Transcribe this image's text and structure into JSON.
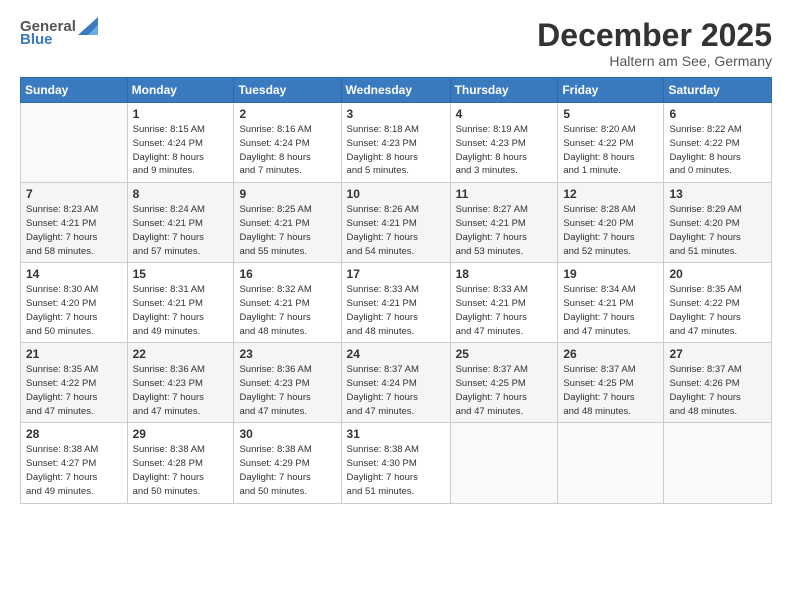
{
  "header": {
    "logo_general": "General",
    "logo_blue": "Blue",
    "month_title": "December 2025",
    "location": "Haltern am See, Germany"
  },
  "weekdays": [
    "Sunday",
    "Monday",
    "Tuesday",
    "Wednesday",
    "Thursday",
    "Friday",
    "Saturday"
  ],
  "weeks": [
    [
      {
        "day": "",
        "info": ""
      },
      {
        "day": "1",
        "info": "Sunrise: 8:15 AM\nSunset: 4:24 PM\nDaylight: 8 hours\nand 9 minutes."
      },
      {
        "day": "2",
        "info": "Sunrise: 8:16 AM\nSunset: 4:24 PM\nDaylight: 8 hours\nand 7 minutes."
      },
      {
        "day": "3",
        "info": "Sunrise: 8:18 AM\nSunset: 4:23 PM\nDaylight: 8 hours\nand 5 minutes."
      },
      {
        "day": "4",
        "info": "Sunrise: 8:19 AM\nSunset: 4:23 PM\nDaylight: 8 hours\nand 3 minutes."
      },
      {
        "day": "5",
        "info": "Sunrise: 8:20 AM\nSunset: 4:22 PM\nDaylight: 8 hours\nand 1 minute."
      },
      {
        "day": "6",
        "info": "Sunrise: 8:22 AM\nSunset: 4:22 PM\nDaylight: 8 hours\nand 0 minutes."
      }
    ],
    [
      {
        "day": "7",
        "info": "Sunrise: 8:23 AM\nSunset: 4:21 PM\nDaylight: 7 hours\nand 58 minutes."
      },
      {
        "day": "8",
        "info": "Sunrise: 8:24 AM\nSunset: 4:21 PM\nDaylight: 7 hours\nand 57 minutes."
      },
      {
        "day": "9",
        "info": "Sunrise: 8:25 AM\nSunset: 4:21 PM\nDaylight: 7 hours\nand 55 minutes."
      },
      {
        "day": "10",
        "info": "Sunrise: 8:26 AM\nSunset: 4:21 PM\nDaylight: 7 hours\nand 54 minutes."
      },
      {
        "day": "11",
        "info": "Sunrise: 8:27 AM\nSunset: 4:21 PM\nDaylight: 7 hours\nand 53 minutes."
      },
      {
        "day": "12",
        "info": "Sunrise: 8:28 AM\nSunset: 4:20 PM\nDaylight: 7 hours\nand 52 minutes."
      },
      {
        "day": "13",
        "info": "Sunrise: 8:29 AM\nSunset: 4:20 PM\nDaylight: 7 hours\nand 51 minutes."
      }
    ],
    [
      {
        "day": "14",
        "info": "Sunrise: 8:30 AM\nSunset: 4:20 PM\nDaylight: 7 hours\nand 50 minutes."
      },
      {
        "day": "15",
        "info": "Sunrise: 8:31 AM\nSunset: 4:21 PM\nDaylight: 7 hours\nand 49 minutes."
      },
      {
        "day": "16",
        "info": "Sunrise: 8:32 AM\nSunset: 4:21 PM\nDaylight: 7 hours\nand 48 minutes."
      },
      {
        "day": "17",
        "info": "Sunrise: 8:33 AM\nSunset: 4:21 PM\nDaylight: 7 hours\nand 48 minutes."
      },
      {
        "day": "18",
        "info": "Sunrise: 8:33 AM\nSunset: 4:21 PM\nDaylight: 7 hours\nand 47 minutes."
      },
      {
        "day": "19",
        "info": "Sunrise: 8:34 AM\nSunset: 4:21 PM\nDaylight: 7 hours\nand 47 minutes."
      },
      {
        "day": "20",
        "info": "Sunrise: 8:35 AM\nSunset: 4:22 PM\nDaylight: 7 hours\nand 47 minutes."
      }
    ],
    [
      {
        "day": "21",
        "info": "Sunrise: 8:35 AM\nSunset: 4:22 PM\nDaylight: 7 hours\nand 47 minutes."
      },
      {
        "day": "22",
        "info": "Sunrise: 8:36 AM\nSunset: 4:23 PM\nDaylight: 7 hours\nand 47 minutes."
      },
      {
        "day": "23",
        "info": "Sunrise: 8:36 AM\nSunset: 4:23 PM\nDaylight: 7 hours\nand 47 minutes."
      },
      {
        "day": "24",
        "info": "Sunrise: 8:37 AM\nSunset: 4:24 PM\nDaylight: 7 hours\nand 47 minutes."
      },
      {
        "day": "25",
        "info": "Sunrise: 8:37 AM\nSunset: 4:25 PM\nDaylight: 7 hours\nand 47 minutes."
      },
      {
        "day": "26",
        "info": "Sunrise: 8:37 AM\nSunset: 4:25 PM\nDaylight: 7 hours\nand 48 minutes."
      },
      {
        "day": "27",
        "info": "Sunrise: 8:37 AM\nSunset: 4:26 PM\nDaylight: 7 hours\nand 48 minutes."
      }
    ],
    [
      {
        "day": "28",
        "info": "Sunrise: 8:38 AM\nSunset: 4:27 PM\nDaylight: 7 hours\nand 49 minutes."
      },
      {
        "day": "29",
        "info": "Sunrise: 8:38 AM\nSunset: 4:28 PM\nDaylight: 7 hours\nand 50 minutes."
      },
      {
        "day": "30",
        "info": "Sunrise: 8:38 AM\nSunset: 4:29 PM\nDaylight: 7 hours\nand 50 minutes."
      },
      {
        "day": "31",
        "info": "Sunrise: 8:38 AM\nSunset: 4:30 PM\nDaylight: 7 hours\nand 51 minutes."
      },
      {
        "day": "",
        "info": ""
      },
      {
        "day": "",
        "info": ""
      },
      {
        "day": "",
        "info": ""
      }
    ]
  ]
}
